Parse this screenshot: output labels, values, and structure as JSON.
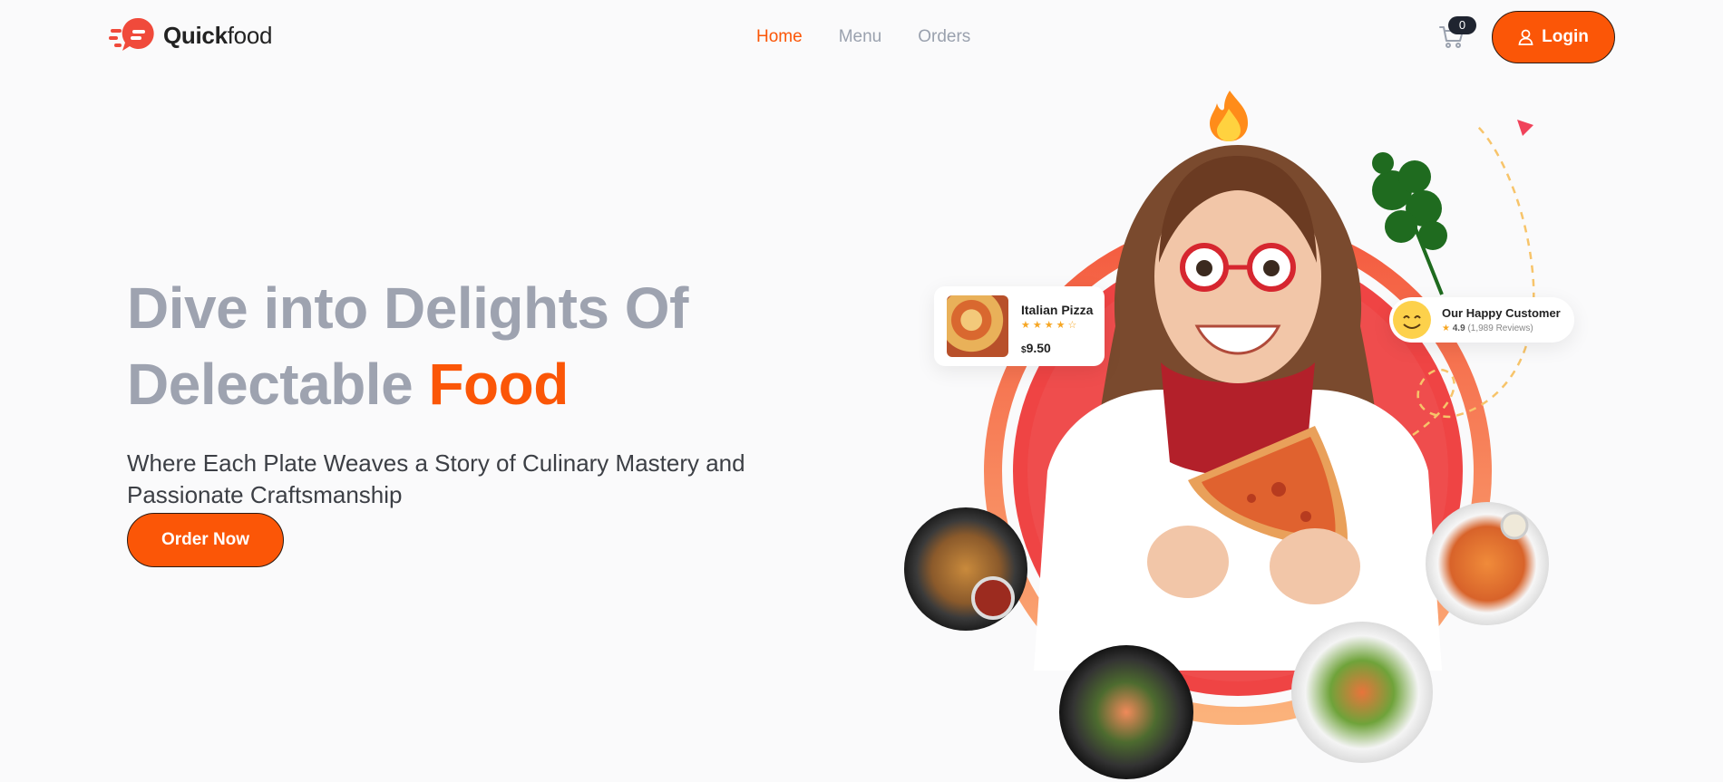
{
  "brand": {
    "name_bold": "Quick",
    "name_light": "food",
    "accent": "#fb5607"
  },
  "nav": {
    "items": [
      {
        "label": "Home",
        "active": true
      },
      {
        "label": "Menu",
        "active": false
      },
      {
        "label": "Orders",
        "active": false
      }
    ]
  },
  "cart": {
    "count": "0",
    "icon": "cart-icon"
  },
  "login": {
    "label": "Login",
    "icon": "user-icon"
  },
  "hero": {
    "title_line1": "Dive into Delights Of",
    "title_line2_pre": "Delectable ",
    "title_line2_accent": "Food",
    "subtitle": "Where Each Plate Weaves a Story of Culinary Mastery and Passionate Craftsmanship",
    "cta": "Order Now"
  },
  "product_card": {
    "name": "Italian Pizza",
    "stars": "★★★★☆",
    "currency": "$",
    "price": "9.50"
  },
  "customer_card": {
    "title": "Our Happy Customer",
    "rating": "4.9",
    "reviews": "(1,989 Reviews)"
  },
  "colors": {
    "accent": "#fb5607",
    "circle": "#ef4444",
    "heading_gray": "#9ea3b0",
    "dark": "#1f2430"
  }
}
